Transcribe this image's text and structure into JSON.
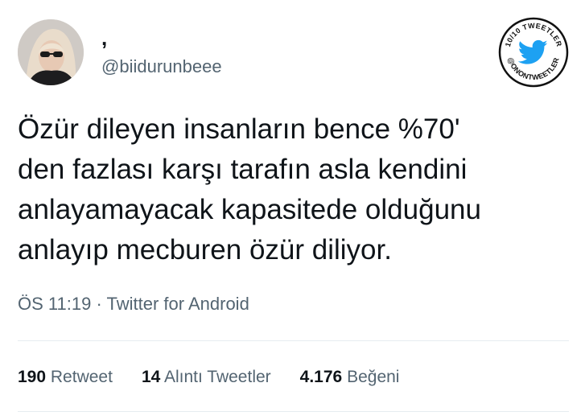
{
  "author": {
    "display_name": ",",
    "handle": "@biidurunbeee",
    "avatar_icon": "profile-photo"
  },
  "watermark": {
    "top_text": "10/10 TWEETLER",
    "bottom_text": "@ONONTWEETLER",
    "icon": "twitter-bird-icon",
    "brand_color": "#1da1f2"
  },
  "tweet": {
    "lines": [
      "Özür dileyen insanların bence %70'",
      "den fazlası karşı tarafın asla kendini",
      "anlayamayacak kapasitede olduğunu",
      "anlayıp mecburen özür diliyor."
    ]
  },
  "meta": {
    "time": "ÖS 11:19",
    "separator": "·",
    "source": "Twitter for Android"
  },
  "stats": {
    "retweets": {
      "count": "190",
      "label": "Retweet"
    },
    "quotes": {
      "count": "14",
      "label": "Alıntı Tweetler"
    },
    "likes": {
      "count": "4.176",
      "label": "Beğeni"
    }
  }
}
